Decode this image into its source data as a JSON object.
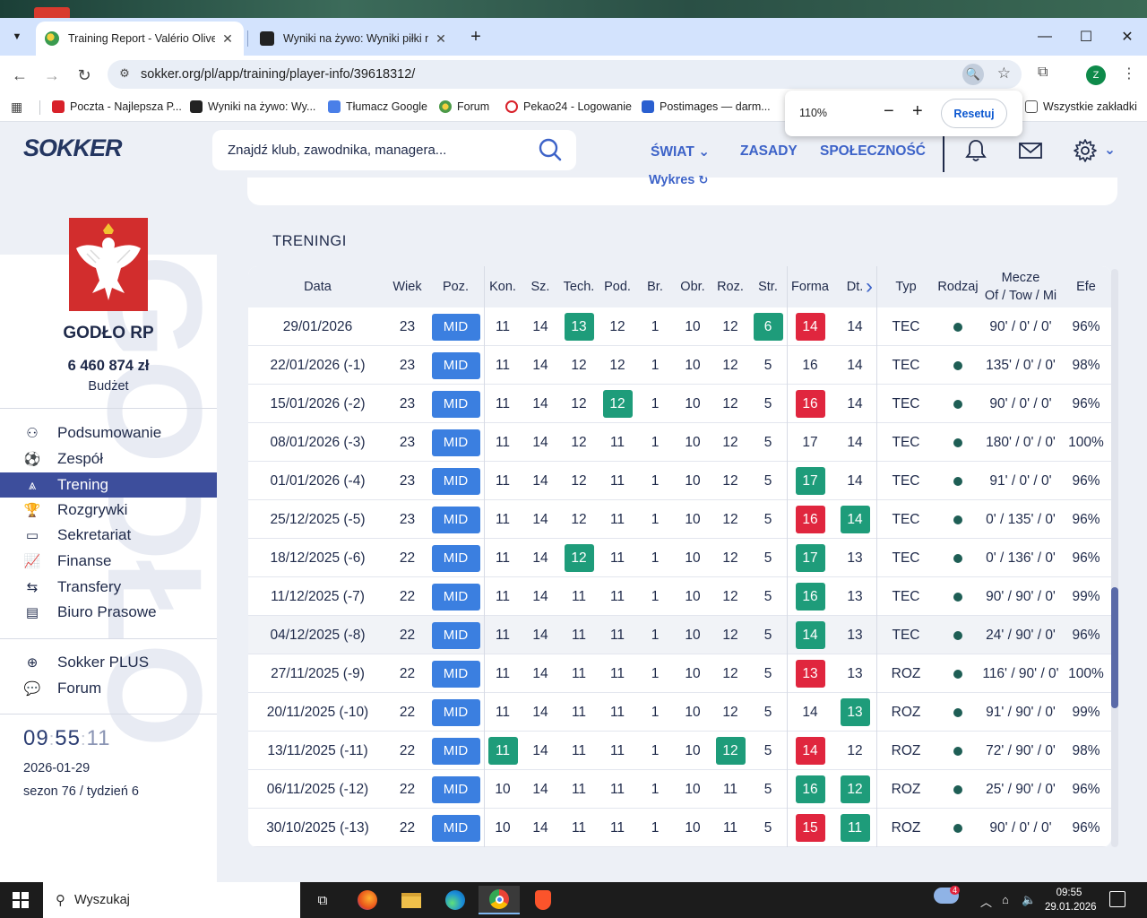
{
  "browser": {
    "tabs": [
      {
        "title": "Training Report - Valério Oliveira",
        "active": true
      },
      {
        "title": "Wyniki na żywo: Wyniki piłki nożnej",
        "active": false
      }
    ],
    "url": "sokker.org/pl/app/training/player-info/39618312/",
    "profile_initial": "Z",
    "bookmarks": [
      {
        "label": "Poczta - Najlepsza P...",
        "color": "#d8212a"
      },
      {
        "label": "Wyniki na żywo: Wy...",
        "color": "#222222"
      },
      {
        "label": "Tłumacz Google",
        "color": "#4a7fe8"
      },
      {
        "label": "Forum",
        "color": "#4c9a48"
      },
      {
        "label": "Pekao24 - Logowanie",
        "color": "#d8212a"
      },
      {
        "label": "Postimages — darm...",
        "color": "#2a5fd0"
      },
      {
        "label": "Wszystkie zakładki",
        "color": "#555555"
      }
    ],
    "zoom": {
      "value": "110%",
      "minus": "−",
      "plus": "+",
      "reset_label": "Resetuj"
    }
  },
  "site": {
    "logo": "SOKKER",
    "search_placeholder": "Znajdź klub, zawodnika, managera...",
    "menu": {
      "world": "ŚWIAT",
      "rules": "ZASADY",
      "community": "SPOŁECZNOŚĆ"
    },
    "chart_link": "Wykres"
  },
  "sidebar": {
    "club_name": "GODŁO RP",
    "budget": "6 460 874 zł",
    "budget_label": "Budżet",
    "watermark": "GODŁO",
    "nav": [
      {
        "label": "Podsumowanie",
        "icon": "summary-icon",
        "active": false
      },
      {
        "label": "Zespół",
        "icon": "ball-icon",
        "active": false
      },
      {
        "label": "Trening",
        "icon": "cone-icon",
        "active": true
      },
      {
        "label": "Rozgrywki",
        "icon": "trophy-icon",
        "active": false
      },
      {
        "label": "Sekretariat",
        "icon": "briefcase-icon",
        "active": false
      },
      {
        "label": "Finanse",
        "icon": "chart-line-icon",
        "active": false
      },
      {
        "label": "Transfery",
        "icon": "transfer-arrows-icon",
        "active": false
      },
      {
        "label": "Biuro Prasowe",
        "icon": "newspaper-icon",
        "active": false
      }
    ],
    "extra": [
      {
        "label": "Sokker PLUS",
        "icon": "plus-circle-icon"
      },
      {
        "label": "Forum",
        "icon": "chat-icon"
      }
    ],
    "clock": {
      "h": "09",
      "m": "55",
      "s": "11",
      "sep": ":"
    },
    "date": "2026-01-29",
    "season": "sezon 76 / tydzień 6"
  },
  "training": {
    "title": "TRENINGI",
    "columns": [
      "Data",
      "Wiek",
      "Poz.",
      "Kon.",
      "Sz.",
      "Tech.",
      "Pod.",
      "Br.",
      "Obr.",
      "Roz.",
      "Str.",
      "Forma",
      "Dt.",
      "Typ",
      "Rodzaj",
      "Mecze\nOf / Tow / Mi",
      "Efe"
    ],
    "rows": [
      {
        "date": "29/01/2026",
        "age": "23",
        "pos": "MID",
        "kon": "11",
        "sz": "14",
        "tech": "13",
        "pod": "12",
        "br": "1",
        "obr": "10",
        "roz": "12",
        "str": "6",
        "forma": "14",
        "dt": "14",
        "typ": "TEC",
        "mecze": "90' / 0' / 0'",
        "efe": "96%",
        "hl": {
          "tech": "g",
          "str": "g",
          "forma": "r"
        }
      },
      {
        "date": "22/01/2026 (-1)",
        "age": "23",
        "pos": "MID",
        "kon": "11",
        "sz": "14",
        "tech": "12",
        "pod": "12",
        "br": "1",
        "obr": "10",
        "roz": "12",
        "str": "5",
        "forma": "16",
        "dt": "14",
        "typ": "TEC",
        "mecze": "135' / 0' / 0'",
        "efe": "98%",
        "hl": {}
      },
      {
        "date": "15/01/2026 (-2)",
        "age": "23",
        "pos": "MID",
        "kon": "11",
        "sz": "14",
        "tech": "12",
        "pod": "12",
        "br": "1",
        "obr": "10",
        "roz": "12",
        "str": "5",
        "forma": "16",
        "dt": "14",
        "typ": "TEC",
        "mecze": "90' / 0' / 0'",
        "efe": "96%",
        "hl": {
          "pod": "g",
          "forma": "r"
        }
      },
      {
        "date": "08/01/2026 (-3)",
        "age": "23",
        "pos": "MID",
        "kon": "11",
        "sz": "14",
        "tech": "12",
        "pod": "11",
        "br": "1",
        "obr": "10",
        "roz": "12",
        "str": "5",
        "forma": "17",
        "dt": "14",
        "typ": "TEC",
        "mecze": "180' / 0' / 0'",
        "efe": "100%",
        "hl": {}
      },
      {
        "date": "01/01/2026 (-4)",
        "age": "23",
        "pos": "MID",
        "kon": "11",
        "sz": "14",
        "tech": "12",
        "pod": "11",
        "br": "1",
        "obr": "10",
        "roz": "12",
        "str": "5",
        "forma": "17",
        "dt": "14",
        "typ": "TEC",
        "mecze": "91' / 0' / 0'",
        "efe": "96%",
        "hl": {
          "forma": "g"
        }
      },
      {
        "date": "25/12/2025 (-5)",
        "age": "23",
        "pos": "MID",
        "kon": "11",
        "sz": "14",
        "tech": "12",
        "pod": "11",
        "br": "1",
        "obr": "10",
        "roz": "12",
        "str": "5",
        "forma": "16",
        "dt": "14",
        "typ": "TEC",
        "mecze": "0' / 135' / 0'",
        "efe": "96%",
        "hl": {
          "forma": "r",
          "dt": "g"
        }
      },
      {
        "date": "18/12/2025 (-6)",
        "age": "22",
        "pos": "MID",
        "kon": "11",
        "sz": "14",
        "tech": "12",
        "pod": "11",
        "br": "1",
        "obr": "10",
        "roz": "12",
        "str": "5",
        "forma": "17",
        "dt": "13",
        "typ": "TEC",
        "mecze": "0' / 136' / 0'",
        "efe": "96%",
        "hl": {
          "tech": "g",
          "forma": "g"
        }
      },
      {
        "date": "11/12/2025 (-7)",
        "age": "22",
        "pos": "MID",
        "kon": "11",
        "sz": "14",
        "tech": "11",
        "pod": "11",
        "br": "1",
        "obr": "10",
        "roz": "12",
        "str": "5",
        "forma": "16",
        "dt": "13",
        "typ": "TEC",
        "mecze": "90' / 90' / 0'",
        "efe": "99%",
        "hl": {
          "forma": "g"
        }
      },
      {
        "date": "04/12/2025 (-8)",
        "age": "22",
        "pos": "MID",
        "kon": "11",
        "sz": "14",
        "tech": "11",
        "pod": "11",
        "br": "1",
        "obr": "10",
        "roz": "12",
        "str": "5",
        "forma": "14",
        "dt": "13",
        "typ": "TEC",
        "mecze": "24' / 90' / 0'",
        "efe": "96%",
        "hl": {
          "forma": "g"
        },
        "row_highlight": true
      },
      {
        "date": "27/11/2025 (-9)",
        "age": "22",
        "pos": "MID",
        "kon": "11",
        "sz": "14",
        "tech": "11",
        "pod": "11",
        "br": "1",
        "obr": "10",
        "roz": "12",
        "str": "5",
        "forma": "13",
        "dt": "13",
        "typ": "ROZ",
        "mecze": "116' / 90' / 0'",
        "efe": "100%",
        "hl": {
          "forma": "r"
        }
      },
      {
        "date": "20/11/2025 (-10)",
        "age": "22",
        "pos": "MID",
        "kon": "11",
        "sz": "14",
        "tech": "11",
        "pod": "11",
        "br": "1",
        "obr": "10",
        "roz": "12",
        "str": "5",
        "forma": "14",
        "dt": "13",
        "typ": "ROZ",
        "mecze": "91' / 90' / 0'",
        "efe": "99%",
        "hl": {
          "dt": "g"
        }
      },
      {
        "date": "13/11/2025 (-11)",
        "age": "22",
        "pos": "MID",
        "kon": "11",
        "sz": "14",
        "tech": "11",
        "pod": "11",
        "br": "1",
        "obr": "10",
        "roz": "12",
        "str": "5",
        "forma": "14",
        "dt": "12",
        "typ": "ROZ",
        "mecze": "72' / 90' / 0'",
        "efe": "98%",
        "hl": {
          "kon": "g",
          "roz": "g",
          "forma": "r"
        }
      },
      {
        "date": "06/11/2025 (-12)",
        "age": "22",
        "pos": "MID",
        "kon": "10",
        "sz": "14",
        "tech": "11",
        "pod": "11",
        "br": "1",
        "obr": "10",
        "roz": "11",
        "str": "5",
        "forma": "16",
        "dt": "12",
        "typ": "ROZ",
        "mecze": "25' / 90' / 0'",
        "efe": "96%",
        "hl": {
          "forma": "g",
          "dt": "g"
        }
      },
      {
        "date": "30/10/2025 (-13)",
        "age": "22",
        "pos": "MID",
        "kon": "10",
        "sz": "14",
        "tech": "11",
        "pod": "11",
        "br": "1",
        "obr": "10",
        "roz": "11",
        "str": "5",
        "forma": "15",
        "dt": "11",
        "typ": "ROZ",
        "mecze": "90' / 0' / 0'",
        "efe": "96%",
        "hl": {
          "forma": "r",
          "dt": "g"
        }
      }
    ]
  },
  "taskbar": {
    "search_placeholder": "Wyszukaj",
    "weather_badge": "4",
    "time": "09:55",
    "date": "29.01.2026"
  },
  "colors": {
    "accent": "#3d63c8",
    "nav_active": "#3d4e9c",
    "badge_green": "#1e9c7a",
    "badge_red": "#e0263e",
    "pill_blue": "#3b7fe0"
  }
}
